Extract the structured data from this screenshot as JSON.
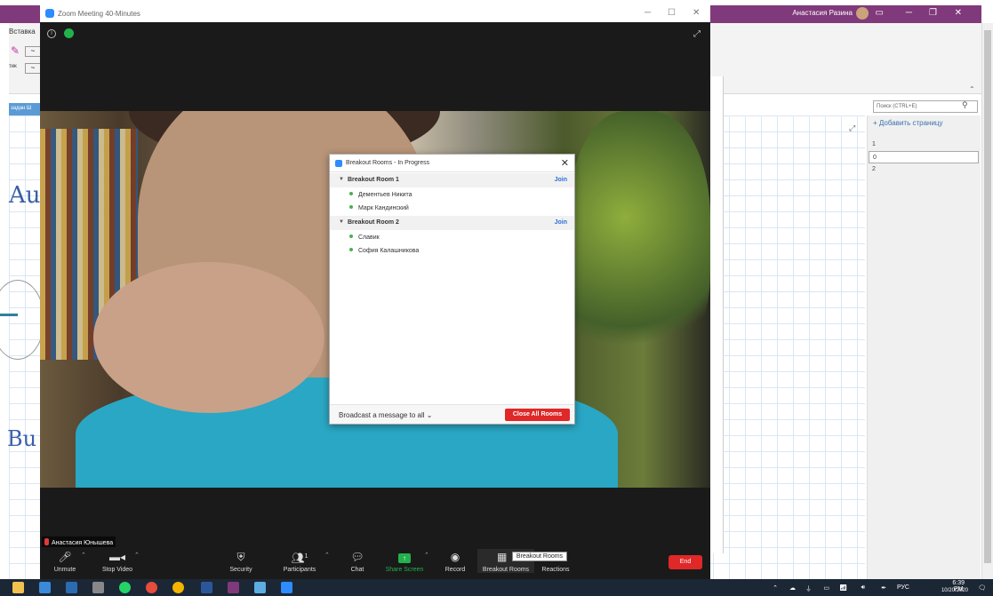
{
  "onenote": {
    "user_name": "Анастасия Разина",
    "ribbon_tab": "Вставка",
    "ribbon_style_label": "тик",
    "section_tab": "задан Ш",
    "search_placeholder": "Поиск (CTRL+E)",
    "add_page": "Добавить страницу",
    "pages": [
      "1",
      "0",
      "2"
    ],
    "handwriting": [
      "Au",
      "Bu"
    ]
  },
  "zoom": {
    "window_title": "Zoom Meeting 40-Minutes",
    "participant_name": "Анастасия Юнышева",
    "toolbar": {
      "unmute": "Unmute",
      "stop_video": "Stop Video",
      "security": "Security",
      "participants": "Participants",
      "participants_count": "1",
      "chat": "Chat",
      "share_screen": "Share Screen",
      "record": "Record",
      "breakout_rooms": "Breakout Rooms",
      "reactions": "Reactions",
      "end": "End",
      "tooltip": "Breakout Rooms"
    }
  },
  "breakout_dialog": {
    "title": "Breakout Rooms - In Progress",
    "rooms": [
      {
        "name": "Breakout Room 1",
        "join": "Join",
        "members": [
          "Дементьев Никита",
          "Марк Кандинский"
        ]
      },
      {
        "name": "Breakout Room 2",
        "join": "Join",
        "members": [
          "Славик",
          "София Калашникова"
        ]
      }
    ],
    "broadcast": "Broadcast a message to all",
    "close_all": "Close All Rooms"
  },
  "taskbar": {
    "language": "РУС",
    "time": "6:39 PM",
    "date": "10/20/2020"
  },
  "colors": {
    "onenote_purple": "#80397b",
    "zoom_blue": "#2d8cff",
    "zoom_red": "#e02828",
    "zoom_green": "#22b14c"
  }
}
